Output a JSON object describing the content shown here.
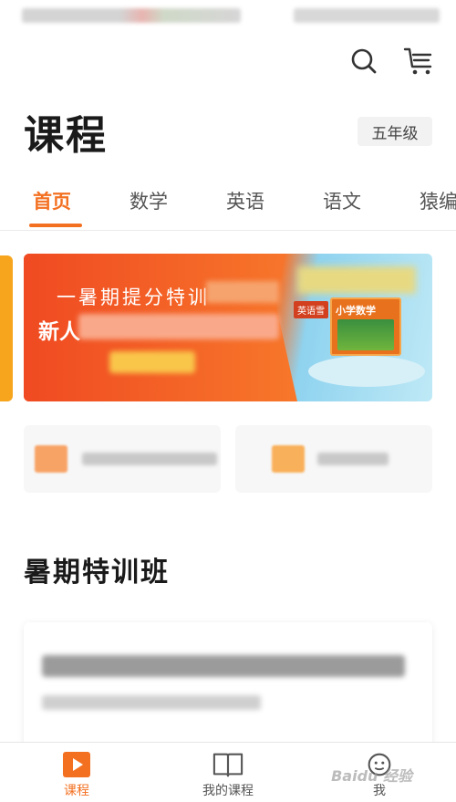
{
  "header": {
    "title": "课程",
    "grade_label": "五年级",
    "icons": [
      "search-icon",
      "cart-icon"
    ]
  },
  "tabs": [
    {
      "label": "首页",
      "active": true
    },
    {
      "label": "数学",
      "active": false
    },
    {
      "label": "英语",
      "active": false
    },
    {
      "label": "语文",
      "active": false
    },
    {
      "label": "猿编",
      "active": false
    }
  ],
  "banner": {
    "line1": "一暑期提分特训",
    "line2_prefix": "新人",
    "book_title": "小学数学",
    "book_tag": "英语雪"
  },
  "section": {
    "title": "暑期特训班"
  },
  "bottom_nav": [
    {
      "label": "课程",
      "icon": "play-icon",
      "active": true
    },
    {
      "label": "我的课程",
      "icon": "book-icon",
      "active": false
    },
    {
      "label": "我",
      "icon": "profile-icon",
      "active": false
    }
  ],
  "watermark": "Baidu 经验",
  "colors": {
    "accent": "#f37021",
    "banner_orange": "#f35e26",
    "banner_blue": "#8fd3ef"
  }
}
